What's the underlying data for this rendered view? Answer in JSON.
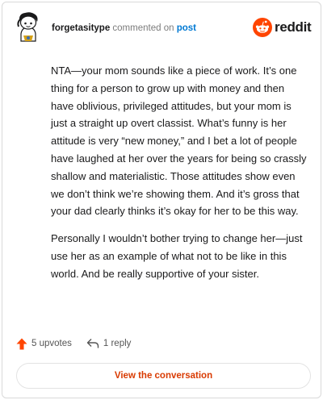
{
  "header": {
    "username": "forgetasitype",
    "action": " commented on ",
    "post_link": "post",
    "brand": "reddit"
  },
  "comment": {
    "paragraphs": [
      "NTA—your mom sounds like a piece of work. It’s one thing for a person to grow up with money and then have oblivious, privileged attitudes, but your mom is just a straight up overt classist. What’s funny is her attitude is very “new money,” and I bet a lot of people have laughed at her over the years for being so crassly shallow and materialistic. Those attitudes show even we don’t think we’re showing them. And it’s gross that your dad clearly thinks it’s okay for her to be this way.",
      "Personally I wouldn’t bother trying to change her—just use her as an example of what not to be like in this world. And be really supportive of your sister."
    ]
  },
  "stats": {
    "upvotes": "5 upvotes",
    "replies": "1 reply"
  },
  "cta": {
    "label": "View the conversation"
  },
  "colors": {
    "brand_orange": "#ff4500",
    "link_blue": "#0079d3",
    "cta_text": "#d93a00",
    "upvote": "#ff4500"
  },
  "icons": {
    "avatar": "snoo-avatar",
    "brand": "reddit-snoo-icon",
    "upvote": "upvote-arrow-icon",
    "reply": "reply-arrow-icon"
  }
}
